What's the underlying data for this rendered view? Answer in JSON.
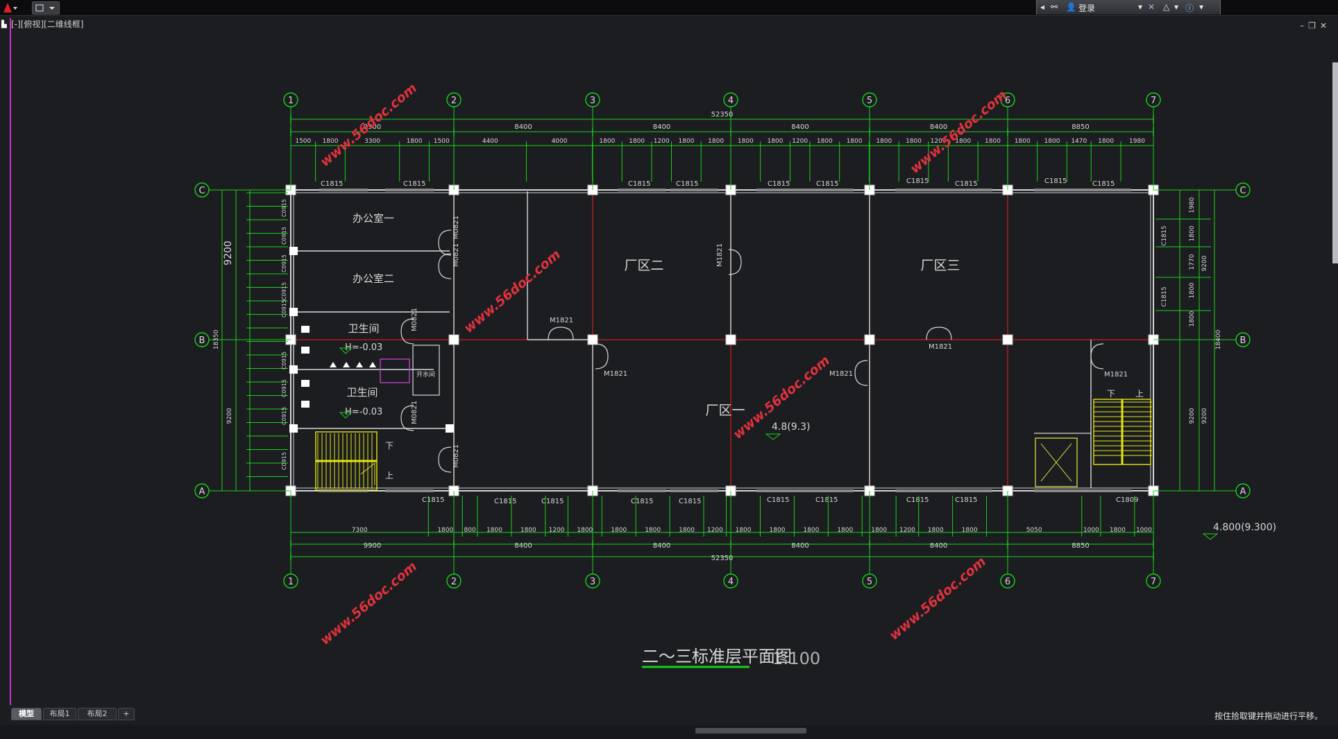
{
  "topbar": {
    "login_label": "登录"
  },
  "viewport_label": "[-][俯视][二维线框]",
  "status_message": "按住拾取键并拖动进行平移。",
  "layout_tabs": [
    "模型",
    "布局1",
    "布局2",
    "+"
  ],
  "drawing": {
    "title": "二～三标准层平面图",
    "title_suffix": "1:100",
    "axes_numeric": [
      "1",
      "2",
      "3",
      "4",
      "5",
      "6",
      "7"
    ],
    "axes_letter": [
      "A",
      "B",
      "C"
    ],
    "total_length": "52350",
    "segment_dims": [
      "9900",
      "8400",
      "8400",
      "8400",
      "8400",
      "8850"
    ],
    "top_detail_dims": [
      "1500",
      "1800",
      "3300",
      "1800",
      "1500",
      "4400",
      "4000",
      "1800",
      "1800",
      "1200",
      "1800",
      "1800",
      "1800",
      "1800",
      "1200",
      "1800",
      "1800",
      "1800",
      "1800",
      "1200",
      "1800",
      "1800",
      "1800",
      "1800",
      "1470",
      "1800",
      "1980"
    ],
    "bottom_detail_dims": [
      "7300",
      "1800",
      "800",
      "1800",
      "1800",
      "1200",
      "1800",
      "1800",
      "1800",
      "1800",
      "1200",
      "1800",
      "1800",
      "1800",
      "1800",
      "1800",
      "1200",
      "1800",
      "1800",
      "5050",
      "1000",
      "1800",
      "1000"
    ],
    "rooms": {
      "office1": "办公室一",
      "office2": "办公室二",
      "wc1": "卫生间",
      "wc2": "卫生间",
      "wc_level": "H=-0.03",
      "plant1": "厂区一",
      "plant2": "厂区二",
      "plant3": "厂区三",
      "pantry": "开水间",
      "down": "下",
      "up": "上"
    },
    "window_tags": [
      "C1815",
      "C1809"
    ],
    "door_tags": [
      "M1821",
      "M0821"
    ],
    "left_total": "18350",
    "left_span": "9200",
    "left_window_tag": "C0915",
    "right_total": "18400",
    "right_span": "9200",
    "right_window_tag": "C1815",
    "right_dims": [
      "1980",
      "1800",
      "1770",
      "1800",
      "1800"
    ],
    "level_label": "4.8(9.3)",
    "level_label_right": "4.800(9.300)",
    "watermark": "www.56doc.com"
  },
  "colors": {
    "background": "#1c1d21",
    "dimension": "#19d219",
    "axis": "#d21d1d",
    "wall": "#d8d8d8",
    "stair": "#e6e612",
    "watermark": "#e0323c",
    "magenta_line": "#d030d0"
  }
}
